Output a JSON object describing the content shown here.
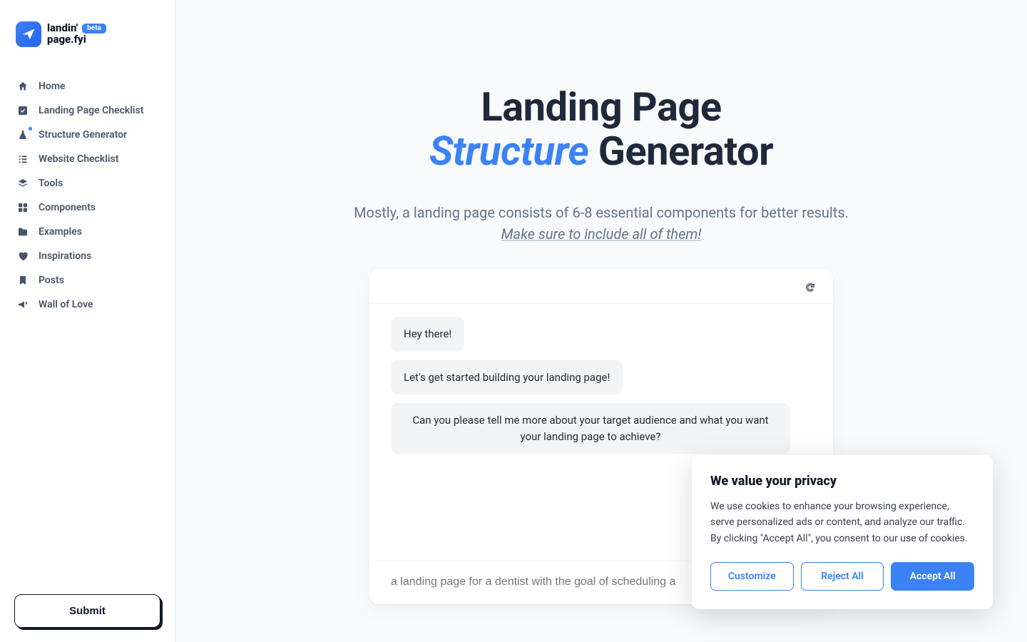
{
  "logo": {
    "line1": "landin'",
    "line2": "page.fyi",
    "badge": "beta"
  },
  "sidebar": {
    "items": [
      {
        "label": "Home",
        "icon": "home-icon"
      },
      {
        "label": "Landing Page Checklist",
        "icon": "check-square-icon"
      },
      {
        "label": "Structure Generator",
        "icon": "flask-icon",
        "badge": true
      },
      {
        "label": "Website Checklist",
        "icon": "list-icon"
      },
      {
        "label": "Tools",
        "icon": "layers-icon"
      },
      {
        "label": "Components",
        "icon": "grid-icon"
      },
      {
        "label": "Examples",
        "icon": "folder-icon"
      },
      {
        "label": "Inspirations",
        "icon": "heart-icon"
      },
      {
        "label": "Posts",
        "icon": "bookmark-icon"
      },
      {
        "label": "Wall of Love",
        "icon": "megaphone-icon"
      }
    ],
    "submit": "Submit"
  },
  "hero": {
    "title_part1": "Landing Page",
    "title_em": "Structure",
    "title_part2": " Generator",
    "subtitle_line1": "Mostly, a landing page consists of 6-8 essential components for better results.",
    "subtitle_line2": "Make sure to include all of them!"
  },
  "chat": {
    "messages": [
      "Hey there!",
      "Let's get started building your landing page!",
      "Can you please tell me more about your target audience and what you want your landing page to achieve?"
    ],
    "input_placeholder": "a landing page for a dentist with the goal of scheduling a"
  },
  "cookie": {
    "title": "We value your privacy",
    "text": "We use cookies to enhance your browsing experience, serve personalized ads or content, and analyze our traffic. By clicking \"Accept All\", you consent to our use of cookies.",
    "customize": "Customize",
    "reject": "Reject All",
    "accept": "Accept All"
  }
}
